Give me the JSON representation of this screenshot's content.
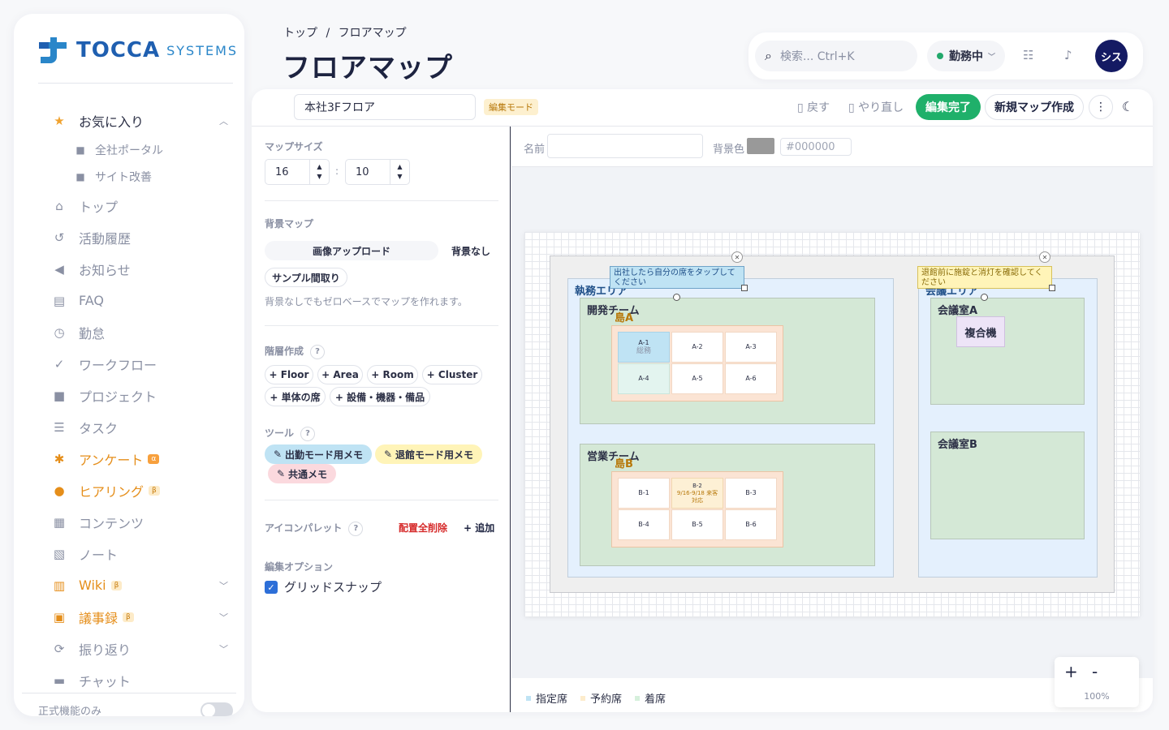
{
  "brand": {
    "name": "TOCCA",
    "sub": "SYSTEMS"
  },
  "sidebar": {
    "favorites": {
      "label": "お気に入り",
      "items": [
        {
          "label": "全社ポータル"
        },
        {
          "label": "サイト改善"
        }
      ]
    },
    "items": [
      {
        "label": "トップ",
        "icon": "home-icon"
      },
      {
        "label": "活動履歴",
        "icon": "history-icon"
      },
      {
        "label": "お知らせ",
        "icon": "megaphone-icon"
      },
      {
        "label": "FAQ",
        "icon": "faq-icon"
      },
      {
        "label": "勤怠",
        "icon": "clock-icon"
      },
      {
        "label": "ワークフロー",
        "icon": "check-circle-icon"
      },
      {
        "label": "プロジェクト",
        "icon": "folder-icon"
      },
      {
        "label": "タスク",
        "icon": "task-icon"
      },
      {
        "label": "アンケート",
        "icon": "bug-icon",
        "badge": "α"
      },
      {
        "label": "ヒアリング",
        "icon": "people-icon",
        "badge": "β"
      },
      {
        "label": "コンテンツ",
        "icon": "document-icon"
      },
      {
        "label": "ノート",
        "icon": "note-icon"
      },
      {
        "label": "Wiki",
        "icon": "book-icon",
        "badge": "β"
      },
      {
        "label": "議事録",
        "icon": "calendar-icon",
        "badge": "β"
      },
      {
        "label": "振り返り",
        "icon": "refresh-icon"
      },
      {
        "label": "チャット",
        "icon": "chat-icon"
      }
    ],
    "footer": "正式機能のみ"
  },
  "breadcrumb": {
    "home": "トップ",
    "sep": "/",
    "current": "フロアマップ"
  },
  "title": "フロアマップ",
  "topbar": {
    "search_placeholder": "検索... Ctrl+K",
    "status": "勤務中",
    "avatar": "シス"
  },
  "toolbar": {
    "floor_name": "本社3Fフロア",
    "mode": "編集モード",
    "undo": "戻す",
    "redo": "やり直し",
    "done": "編集完了",
    "new": "新規マップ作成"
  },
  "left": {
    "map_size": {
      "label": "マップサイズ",
      "w": "16",
      "h": "10",
      "sep": ":"
    },
    "bg_map": {
      "label": "背景マップ",
      "upload": "画像アップロード",
      "none": "背景なし",
      "sample": "サンプル間取り",
      "hint": "背景なしでもゼロベースでマップを作れます。"
    },
    "hierarchy": {
      "label": "階層作成",
      "q": "?",
      "buttons": [
        "+ Floor",
        "+ Area",
        "+ Room",
        "+ Cluster",
        "+ 単体の席",
        "+ 設備・機器・備品"
      ]
    },
    "tools": {
      "label": "ツール",
      "q": "?",
      "items": [
        "出勤モード用メモ",
        "退館モード用メモ",
        "共通メモ"
      ]
    },
    "palette": {
      "label": "アイコンパレット",
      "q": "?",
      "delete": "配置全削除",
      "add": "+ 追加"
    },
    "options": {
      "label": "編集オプション",
      "grid_snap": "グリッドスナップ"
    }
  },
  "props": {
    "name_label": "名前",
    "name_value": "",
    "bg_label": "背景色",
    "bg_hex": "#000000",
    "bg_swatch": "#999999"
  },
  "map": {
    "area_left": "執務エリア",
    "area_right": "会議エリア",
    "memo_left": "出社したら自分の席をタップしてください",
    "memo_right": "退館前に施錠と消灯を確認してください",
    "room_dev": "開発チーム",
    "island_a": "島A",
    "room_sales": "営業チーム",
    "island_b": "島B",
    "room_meet_a": "会議室A",
    "room_meet_b": "会議室B",
    "equipment": "複合機",
    "seats_a": [
      {
        "id": "A-1",
        "sub": "総務"
      },
      {
        "id": "A-2",
        "sub": ""
      },
      {
        "id": "A-3",
        "sub": ""
      },
      {
        "id": "A-4",
        "sub": ""
      },
      {
        "id": "A-5",
        "sub": ""
      },
      {
        "id": "A-6",
        "sub": ""
      }
    ],
    "seats_b": [
      {
        "id": "B-1",
        "sub": ""
      },
      {
        "id": "B-2",
        "sub": "9/16-9/18 来客対応"
      },
      {
        "id": "B-3",
        "sub": ""
      },
      {
        "id": "B-4",
        "sub": ""
      },
      {
        "id": "B-5",
        "sub": ""
      },
      {
        "id": "B-6",
        "sub": ""
      }
    ]
  },
  "zoom": {
    "plus": "+",
    "minus": "-",
    "level": "100%"
  },
  "legend": [
    {
      "label": "指定席",
      "color": "#bfe3f4"
    },
    {
      "label": "予約席",
      "color": "#fdeccc"
    },
    {
      "label": "着席",
      "color": "#d6f0dc"
    }
  ]
}
